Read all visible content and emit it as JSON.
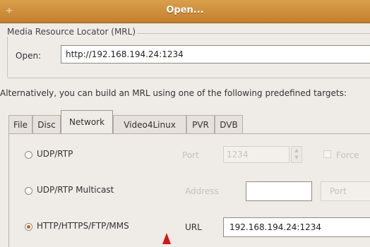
{
  "window": {
    "title": "Open...",
    "menu_icon": "window-menu-icon"
  },
  "mrl": {
    "legend": "Media Resource Locator (MRL)",
    "open_label": "Open:",
    "open_value": "http://192.168.194.24:1234"
  },
  "alternative_text": "Alternatively, you can build an MRL using one of the following predefined targets:",
  "tabs": [
    {
      "label": "File",
      "active": false
    },
    {
      "label": "Disc",
      "active": false
    },
    {
      "label": "Network",
      "active": true
    },
    {
      "label": "Video4Linux",
      "active": false
    },
    {
      "label": "PVR",
      "active": false
    },
    {
      "label": "DVB",
      "active": false
    }
  ],
  "network": {
    "options": [
      {
        "label": "UDP/RTP",
        "selected": false
      },
      {
        "label": "UDP/RTP Multicast",
        "selected": false
      },
      {
        "label": "HTTP/HTTPS/FTP/MMS",
        "selected": true
      }
    ],
    "udp": {
      "port_label": "Port",
      "port_value": "1234",
      "force_label": "Force"
    },
    "multicast": {
      "address_label": "Address",
      "address_value": "",
      "port_label": "Port"
    },
    "http": {
      "url_label": "URL",
      "url_value": "192.168.194.24:1234"
    }
  },
  "colors": {
    "titlebar": "#c47f2e",
    "cursor": "#d11818"
  }
}
